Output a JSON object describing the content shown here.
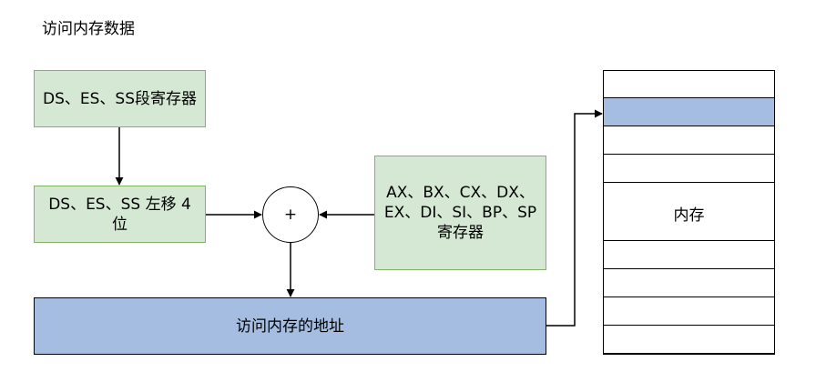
{
  "title": "访问内存数据",
  "boxes": {
    "segment_registers": "DS、ES、SS段寄存器",
    "shifted": "DS、ES、SS 左移 4 位",
    "general_registers": "AX、BX、CX、DX、EX、DI、SI、BP、SP 寄存器",
    "address": "访问内存的地址"
  },
  "adder_symbol": "+",
  "memory": {
    "label": "内存",
    "row_count": 10,
    "highlighted_row": 1
  },
  "colors": {
    "green_fill": "#d5e8d4",
    "green_border": "#82b366",
    "blue_fill": "#a4bde0",
    "line": "#000000"
  }
}
